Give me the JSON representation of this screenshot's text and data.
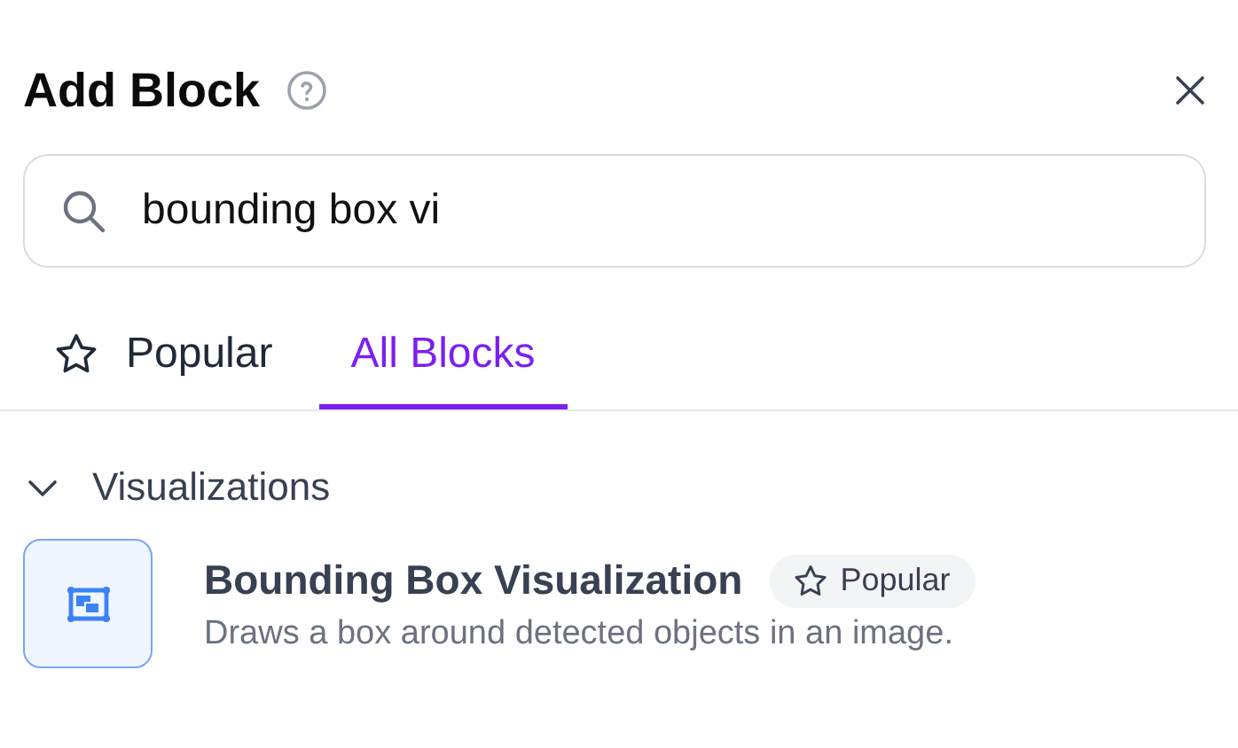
{
  "header": {
    "title": "Add Block"
  },
  "search": {
    "value": "bounding box vi"
  },
  "tabs": [
    {
      "label": "Popular",
      "selected": false,
      "kind": "starred"
    },
    {
      "label": "All Blocks",
      "selected": true,
      "kind": "plain"
    }
  ],
  "sections": [
    {
      "title": "Visualizations",
      "expanded": true,
      "items": [
        {
          "name": "Bounding Box Visualization",
          "badge": "Popular",
          "description": "Draws a box around detected objects in an image."
        }
      ]
    }
  ]
}
